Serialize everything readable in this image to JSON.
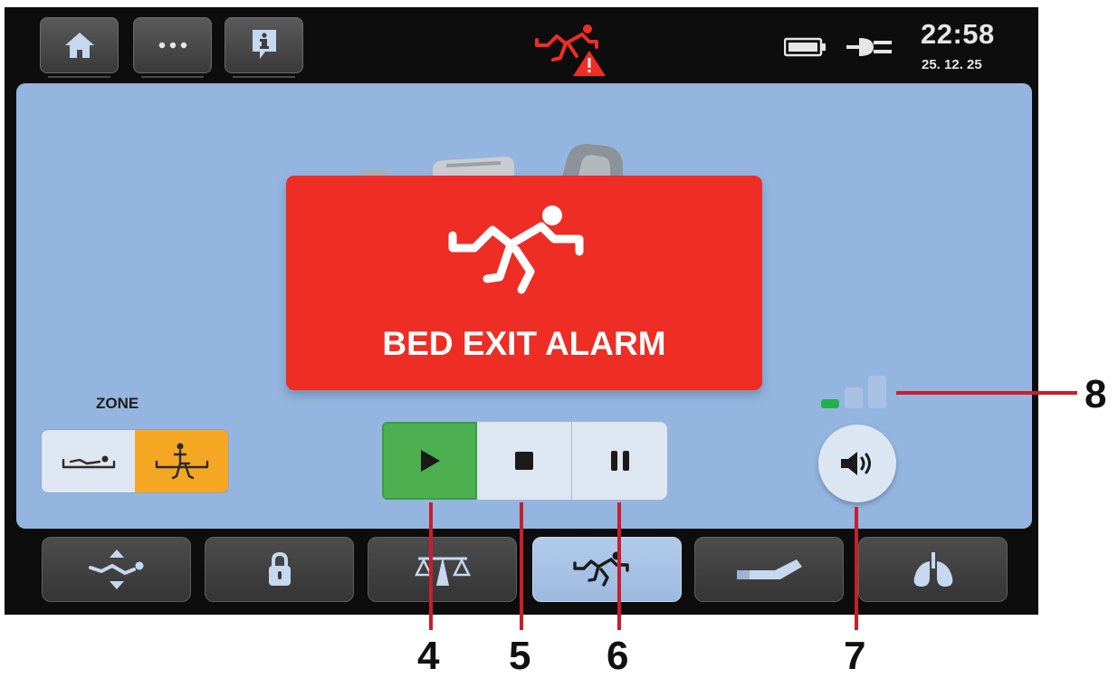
{
  "status_bar": {
    "time": "22:58",
    "date": "25. 12. 25",
    "icons": [
      "home-icon",
      "more-icon",
      "info-icon",
      "bed-exit-warning-icon",
      "battery-icon",
      "mains-plug-icon"
    ]
  },
  "alarm": {
    "title": "BED EXIT ALARM",
    "icon": "bed-exit-icon",
    "color": "#ee2d24"
  },
  "zone": {
    "label": "ZONE",
    "options": [
      {
        "icon": "lying-in-bed-icon",
        "selected": false
      },
      {
        "icon": "sitting-on-edge-icon",
        "selected": true
      }
    ],
    "selected_color": "#f5a623"
  },
  "controls": {
    "buttons": [
      {
        "icon": "play-icon",
        "active": true
      },
      {
        "icon": "stop-icon",
        "active": false
      },
      {
        "icon": "pause-icon",
        "active": false
      }
    ],
    "active_color": "#4caf50"
  },
  "volume": {
    "icon": "speaker-icon",
    "level": 1,
    "levels": 3,
    "active_color": "#22b04b"
  },
  "bottom_nav": [
    {
      "icon": "bed-height-icon",
      "selected": false
    },
    {
      "icon": "lock-icon",
      "selected": false
    },
    {
      "icon": "scale-icon",
      "selected": false
    },
    {
      "icon": "bed-exit-icon",
      "selected": true
    },
    {
      "icon": "bed-position-icon",
      "selected": false
    },
    {
      "icon": "lungs-icon",
      "selected": false
    }
  ],
  "callouts": [
    "4",
    "5",
    "6",
    "7",
    "8"
  ]
}
